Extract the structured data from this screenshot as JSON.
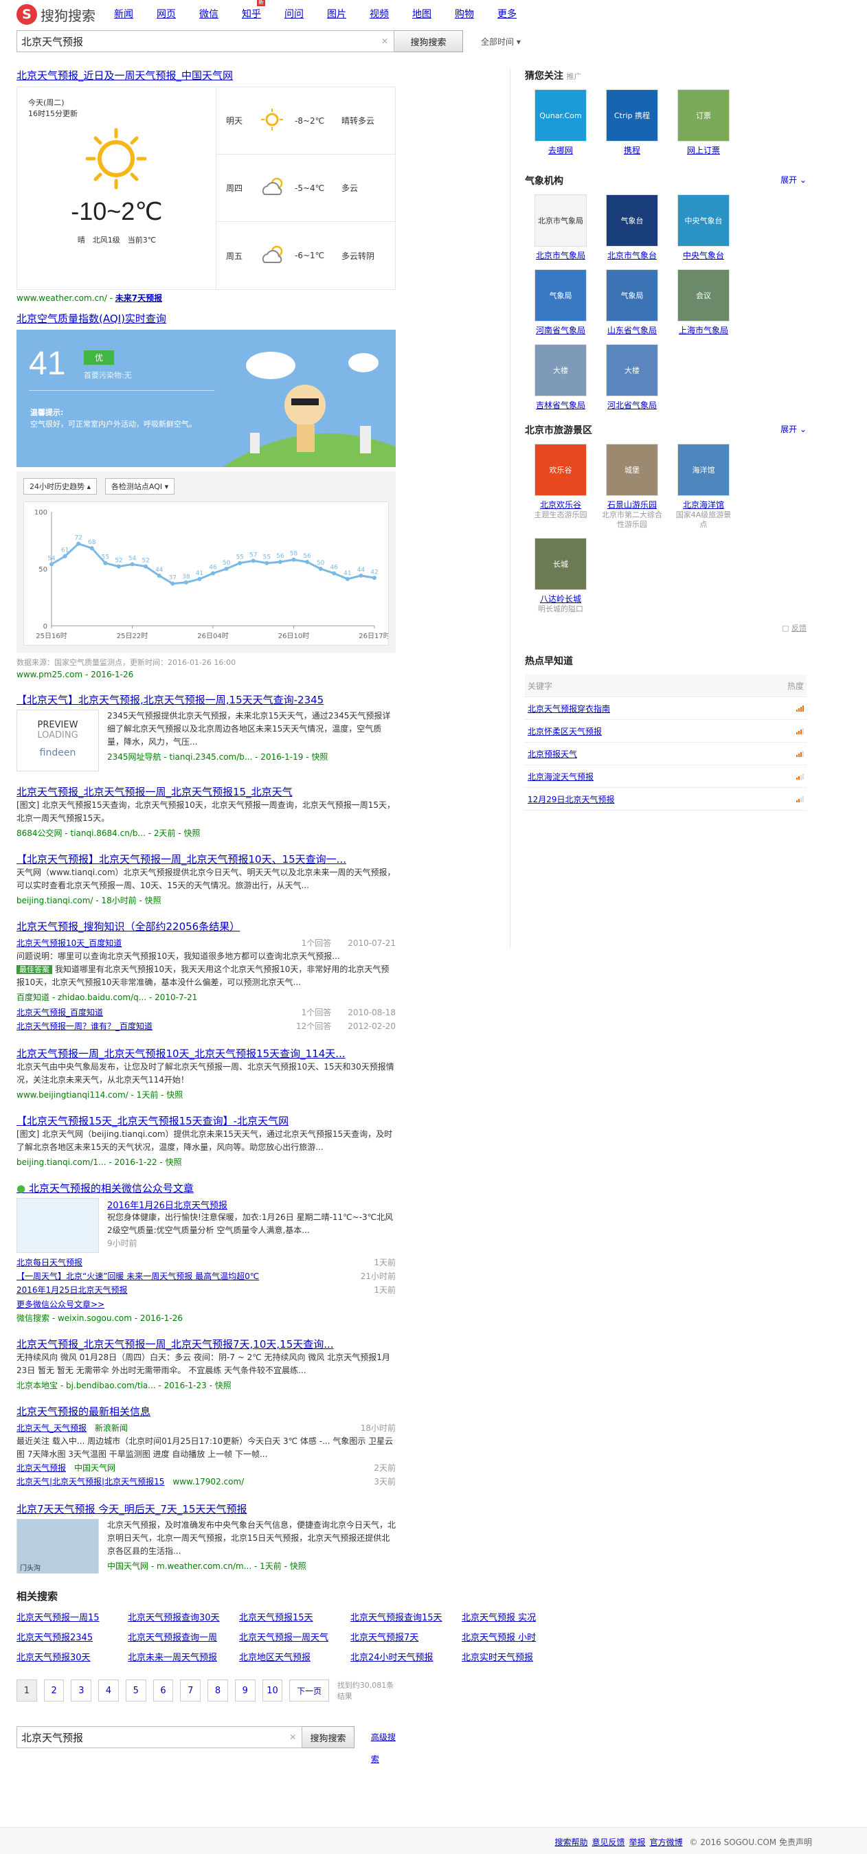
{
  "header": {
    "logo_text": "搜狗搜索",
    "nav": [
      {
        "label": "新闻"
      },
      {
        "label": "网页",
        "current": true
      },
      {
        "label": "微信"
      },
      {
        "label": "知乎",
        "new": "新"
      },
      {
        "label": "问问"
      },
      {
        "label": "图片"
      },
      {
        "label": "视频"
      },
      {
        "label": "地图"
      },
      {
        "label": "购物"
      },
      {
        "label": "更多"
      }
    ],
    "search_value": "北京天气预报",
    "search_button": "搜狗搜索",
    "time_filter": "全部时间"
  },
  "weather_card": {
    "title": "北京天气预报_近日及一周天气预报_中国天气网",
    "today_label": "今天(周二)",
    "update": "16时15分更新",
    "today_temp": "-10~2℃",
    "today_desc": "晴　北风1级　当前3℃",
    "days": [
      {
        "day": "明天",
        "temp": "-8~2℃",
        "desc": "晴转多云",
        "icon": "sun-icon"
      },
      {
        "day": "周四",
        "temp": "-5~4℃",
        "desc": "多云",
        "icon": "cloud-sun-icon"
      },
      {
        "day": "周五",
        "temp": "-6~1℃",
        "desc": "多云转阴",
        "icon": "cloud-sun-icon"
      }
    ],
    "url": "www.weather.com.cn/",
    "more": "未来7天预报"
  },
  "aqi_card": {
    "title": "北京空气质量指数(AQI)实时查询",
    "value": "41",
    "level": "优",
    "hint": "首要污染物:无",
    "tip_title": "温馨提示:",
    "tip": "空气很好，可正常室内户外活动，呼吸新鲜空气。",
    "select1": "24小时历史趋势",
    "select2": "各检测站点AQI",
    "source": "数据来源：国家空气质量监测点，更新时间：2016-01-26 16:00",
    "url": "www.pm25.com - 2016-1-26"
  },
  "chart_data": {
    "type": "line",
    "ylim": [
      0,
      100
    ],
    "yticks": [
      0,
      50,
      100
    ],
    "xtick_labels": [
      "25日16时",
      "25日22时",
      "26日04时",
      "26日10时",
      "26日17时"
    ],
    "values": [
      54,
      61,
      72,
      68,
      55,
      52,
      54,
      52,
      44,
      37,
      38,
      41,
      46,
      50,
      55,
      57,
      55,
      56,
      58,
      56,
      50,
      46,
      41,
      44,
      42
    ],
    "labels_shown": true
  },
  "results": [
    {
      "title": "【北京天气】北京天气预报,北京天气预报一周,15天天气查询-2345",
      "desc": "2345天气预报提供北京天气预报，未来北京15天天气，通过2345天气预报详细了解北京天气预报以及北京周边各地区未来15天天气情况，温度，空气质量，降水，风力，气压...",
      "url": "2345网址导航 - tianqi.2345.com/b... - 2016-1-19 - 快照",
      "thumb_text1": "PREVIEW",
      "thumb_text2": "LOADING",
      "thumb_text3": "findeen"
    },
    {
      "title": "北京天气预报_北京天气预报一周_北京天气预报15_北京天气",
      "desc": "[图文] 北京天气预报15天查询，北京天气预报10天，北京天气预报一周查询，北京天气预报一周15天，北京一周天气预报15天。",
      "url": "8684公交网 - tianqi.8684.cn/b... - 2天前 - 快照"
    },
    {
      "title": "【北京天气预报】北京天气预报一周_北京天气预报10天、15天查询一...",
      "desc": "天气网（www.tianqi.com）北京天气预报提供北京今日天气、明天天气以及北京未来一周的天气预报，可以实时查看北京天气预报一周、10天、15天的天气情况。旅游出行，从天气...",
      "url": "beijing.tianqi.com/ - 18小时前 - 快照"
    }
  ],
  "zhidao": {
    "title": "北京天气预报_搜狗知识（全部约22056条结果）",
    "q1": {
      "title": "北京天气预报10天_百度知道",
      "answers": "1个回答",
      "date": "2010-07-21"
    },
    "q1_desc": "问题说明：哪里可以查询北京天气预报10天，我知道很多地方都可以查询北京天气预报...",
    "best_label": "最佳答案",
    "best": "我知道哪里有北京天气预报10天，我天天用这个北京天气预报10天，非常好用的北京天气预报10天，北京天气预报10天非常准确，基本没什么偏差，可以预测北京天气...",
    "source": "百度知道 - zhidao.baidu.com/q... - 2010-7-21",
    "q2": {
      "title": "北京天气预报_百度知道",
      "answers": "1个回答",
      "date": "2010-08-18"
    },
    "q3": {
      "title": "北京天气预报一周？谁有？_百度知道",
      "answers": "12个回答",
      "date": "2012-02-20"
    }
  },
  "results2": [
    {
      "title": "北京天气预报一周_北京天气预报10天_北京天气预报15天查询_114天...",
      "desc": "北京天气由中央气象局发布，让您及时了解北京天气预报一周、北京天气预报10天、15天和30天预报情况，关注北京未来天气，从北京天气114开始！",
      "url": "www.beijingtianqi114.com/ - 1天前 - 快照"
    },
    {
      "title": "【北京天气预报15天_北京天气预报15天查询】-北京天气网",
      "desc": "[图文] 北京天气网（beijing.tianqi.com）提供北京未来15天天气，通过北京天气预报15天查询，及时了解北京各地区未来15天的天气状况，温度，降水量，风向等。助您放心出行旅游...",
      "url": "beijing.tianqi.com/1... - 2016-1-22 - 快照"
    }
  ],
  "weixin": {
    "title": "北京天气预报的相关微信公众号文章",
    "main_title": "2016年1月26日北京天气预报",
    "main_desc": "祝您身体健康，出行愉快!注意保暖，加衣:1月26日 星期二晴-11℃~-3℃北风2级空气质量:优空气质量分析 空气质量令人满意,基本...",
    "main_time": "9小时前",
    "items": [
      {
        "title": "北京每日天气预报",
        "time": "1天前"
      },
      {
        "title": "【一周天气】北京“火速”回暖 未来一周天气预报 最高气温均超0℃",
        "time": "21小时前"
      },
      {
        "title": "2016年1月25日北京天气预报",
        "time": "1天前"
      }
    ],
    "more": "更多微信公众号文章>>",
    "source": "微信搜索 - weixin.sogou.com - 2016-1-26"
  },
  "results3": [
    {
      "title": "北京天气预报_北京天气预报一周_北京天气预报7天,10天,15天查询...",
      "desc": "无持续风向 微风 01月28日（周四）白天：多云 夜间：阴-7 ~ 2℃ 无持续风向 微风 北京天气预报1月23日 暂无 暂无 无需带伞 外出时无需带雨伞。 不宜晨练 天气条件较不宜晨练...",
      "url": "北京本地宝 - bj.bendibao.com/tia... - 2016-1-23 - 快照"
    }
  ],
  "news": {
    "title": "北京天气预报的最新相关信息",
    "n1": {
      "title": "北京天气_天气预报",
      "site": "新浪新闻",
      "time": "18小时前"
    },
    "n1_desc": "最近关注 载入中... 周边城市（北京时间01月25日17:10更新）今天白天 3℃ 体感 -... 气象图示 卫星云图 7天降水图 3天气温图 干旱监测图 进度 自动播放 上一帧 下一帧...",
    "n2": {
      "title": "北京天气预报",
      "site": "中国天气网",
      "time": "2天前"
    },
    "n3": {
      "title": "北京天气|北京天气预报|北京天气预报15",
      "site": "www.17902.com/",
      "time": "3天前"
    }
  },
  "results4": {
    "title": "北京7天天气预报 今天_明后天_7天_15天天气预报",
    "desc": "北京天气预报，及时准确发布中央气象台天气信息，便捷查询北京今日天气，北京明日天气，北京一周天气预报，北京15日天气预报，北京天气预报还提供北京各区县的生活指...",
    "url": "中国天气网 - m.weather.com.cn/m... - 1天前 - 快照",
    "thumb_text": "门头沟"
  },
  "related_title": "相关搜索",
  "related": [
    "北京天气预报一周15",
    "北京天气预报查询30天",
    "北京天气预报15天",
    "北京天气预报查询15天",
    "北京天气预报 实况",
    "北京天气预报2345",
    "北京天气预报查询一周",
    "北京天气预报一周天气",
    "北京天气预报7天",
    "北京天气预报 小时",
    "北京天气预报30天",
    "北京未来一周天气预报",
    "北京地区天气预报",
    "北京24小时天气预报",
    "北京实时天气预报"
  ],
  "pager": {
    "pages": [
      "1",
      "2",
      "3",
      "4",
      "5",
      "6",
      "7",
      "8",
      "9",
      "10"
    ],
    "next": "下一页",
    "count": "找到约30,081条结果"
  },
  "bottom_search": {
    "value": "北京天气预报",
    "button": "搜狗搜索",
    "advanced": "高级搜索"
  },
  "side": {
    "guess": {
      "title": "猜您关注",
      "ad": "推广",
      "items": [
        {
          "label": "去哪网",
          "img": "Qunar.Com",
          "color": "#1a9bd6"
        },
        {
          "label": "携程",
          "img": "Ctrip 携程",
          "color": "#1764b1"
        },
        {
          "label": "网上订票",
          "img": "订票",
          "color": "#7aa95a"
        }
      ]
    },
    "agency": {
      "title": "气象机构",
      "expand": "展开",
      "items": [
        {
          "label": "北京市气象局",
          "img": "北京市气象局",
          "color": "#f4f4f4"
        },
        {
          "label": "北京市气象台",
          "img": "气象台",
          "color": "#1a3e7a"
        },
        {
          "label": "中央气象台",
          "img": "中央气象台",
          "color": "#2a93c4"
        },
        {
          "label": "河南省气象局",
          "img": "气象局",
          "color": "#3a78c4"
        },
        {
          "label": "山东省气象局",
          "img": "气象局",
          "color": "#3b73b5"
        },
        {
          "label": "上海市气象局",
          "img": "会议",
          "color": "#6a8a6a"
        },
        {
          "label": "吉林省气象局",
          "img": "大楼",
          "color": "#7f9ab8"
        },
        {
          "label": "河北省气象局",
          "img": "大楼",
          "color": "#5b86bd"
        }
      ]
    },
    "tour": {
      "title": "北京市旅游景区",
      "expand": "展开",
      "items": [
        {
          "label": "北京欢乐谷",
          "sub": "主题生态游乐园",
          "img": "欢乐谷",
          "color": "#e8481e"
        },
        {
          "label": "石景山游乐园",
          "sub": "北京市第二大综合性游乐园",
          "img": "城堡",
          "color": "#9b8a70"
        },
        {
          "label": "北京海洋馆",
          "sub": "国家4A级旅游景点",
          "img": "海洋馆",
          "color": "#4d86bd"
        },
        {
          "label": "八达岭长城",
          "sub": "明长城的隘口",
          "img": "长城",
          "color": "#6d7b55"
        }
      ]
    },
    "feedback": "反馈",
    "hot": {
      "title": "热点早知道",
      "col1": "关键字",
      "col2": "热度",
      "items": [
        {
          "label": "北京天气预报穿衣指南",
          "heat": 4
        },
        {
          "label": "北京怀柔区天气预报",
          "heat": 3
        },
        {
          "label": "北京预报天气",
          "heat": 3
        },
        {
          "label": "北京海淀天气预报",
          "heat": 2
        },
        {
          "label": "12月29日北京天气预报",
          "heat": 2
        }
      ]
    }
  },
  "footer": {
    "links": [
      "搜索帮助",
      "意见反馈",
      "举报",
      "官方微博"
    ],
    "copy": "© 2016 SOGOU.COM",
    "disclaimer": "免责声明"
  }
}
